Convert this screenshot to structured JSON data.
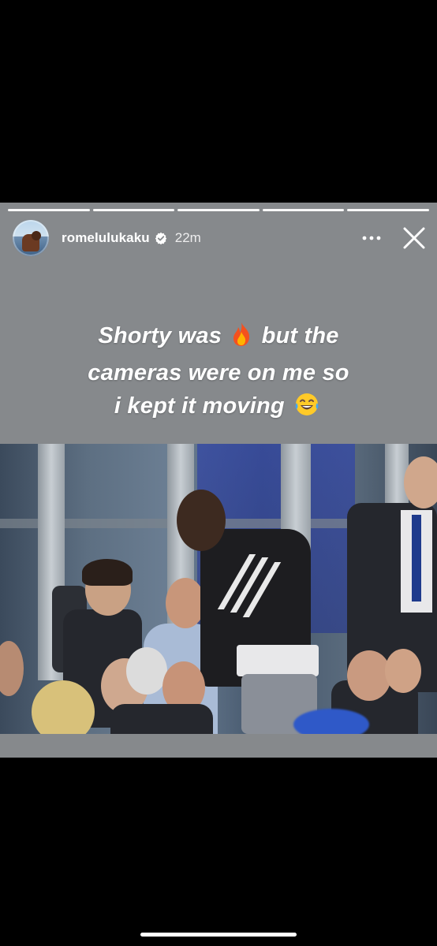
{
  "story": {
    "username": "romelulukaku",
    "timestamp": "22m",
    "verified": true,
    "progress": {
      "segments_total": 5,
      "segments_viewed": 5
    },
    "caption_lines": [
      "Shorty was",
      "but the",
      "cameras were on me so",
      "i kept it moving"
    ],
    "emoji": {
      "fire": "fire-emoji",
      "laughing": "tears-of-joy-emoji"
    },
    "image": {
      "description_icon": "stadium-photo"
    }
  },
  "icons": {
    "more": "more-options-icon",
    "close": "close-icon",
    "verified": "verified-badge-icon"
  },
  "colors": {
    "background": "#000000",
    "story_bg": "#86898c",
    "text": "#ffffff",
    "verified_badge": "#ffffff"
  }
}
